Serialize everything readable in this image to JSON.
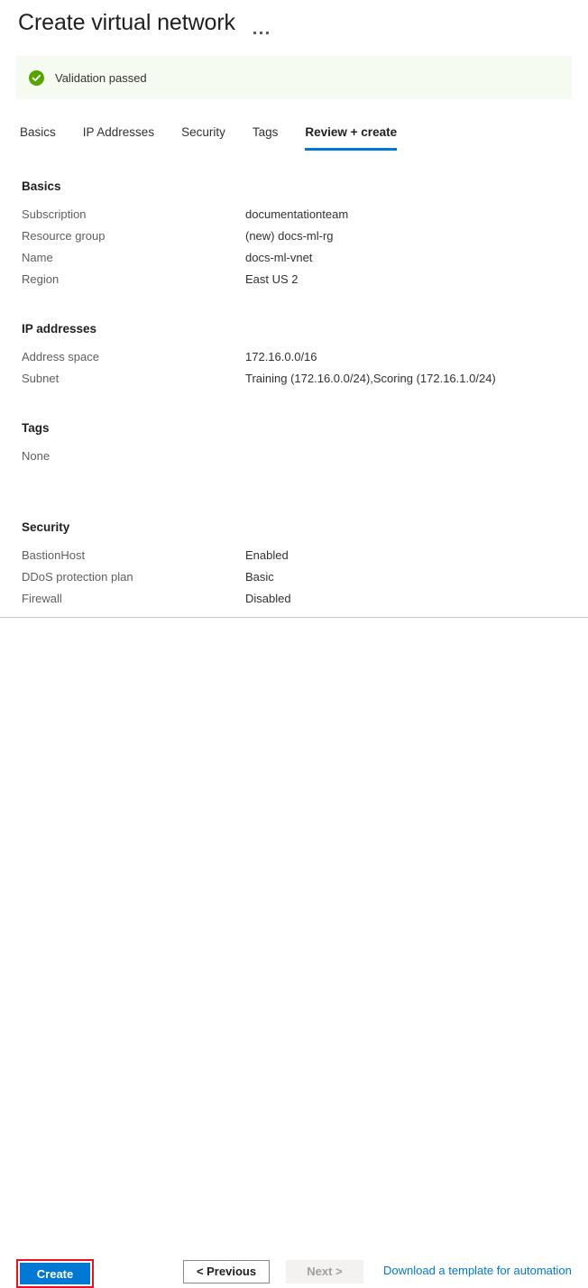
{
  "header": {
    "title": "Create virtual network",
    "more_menu_icon": "ellipsis-horizontal-icon"
  },
  "banner": {
    "icon": "check-circle-icon",
    "text": "Validation passed",
    "background": "#f6fbf1",
    "icon_color": "#57a300"
  },
  "tabs": [
    {
      "label": "Basics",
      "active": false
    },
    {
      "label": "IP Addresses",
      "active": false
    },
    {
      "label": "Security",
      "active": false
    },
    {
      "label": "Tags",
      "active": false
    },
    {
      "label": "Review + create",
      "active": true
    }
  ],
  "accent_color": "#0078d4",
  "highlight_color": "#e81123",
  "sections": {
    "basics": {
      "heading": "Basics",
      "rows": [
        {
          "label": "Subscription",
          "value": "documentationteam"
        },
        {
          "label": "Resource group",
          "value": "(new) docs-ml-rg"
        },
        {
          "label": "Name",
          "value": "docs-ml-vnet"
        },
        {
          "label": "Region",
          "value": "East US 2"
        }
      ]
    },
    "ip_addresses": {
      "heading": "IP addresses",
      "rows": [
        {
          "label": "Address space",
          "value": "172.16.0.0/16"
        },
        {
          "label": "Subnet",
          "value": "Training (172.16.0.0/24),Scoring (172.16.1.0/24)"
        }
      ]
    },
    "tags": {
      "heading": "Tags",
      "empty_text": "None"
    },
    "security": {
      "heading": "Security",
      "rows": [
        {
          "label": "BastionHost",
          "value": "Enabled"
        },
        {
          "label": "DDoS protection plan",
          "value": "Basic"
        },
        {
          "label": "Firewall",
          "value": "Disabled"
        }
      ]
    }
  },
  "footer": {
    "create_label": "Create",
    "previous_label": "< Previous",
    "next_label": "Next >",
    "next_disabled": true,
    "download_link_label": "Download a template for automation"
  }
}
